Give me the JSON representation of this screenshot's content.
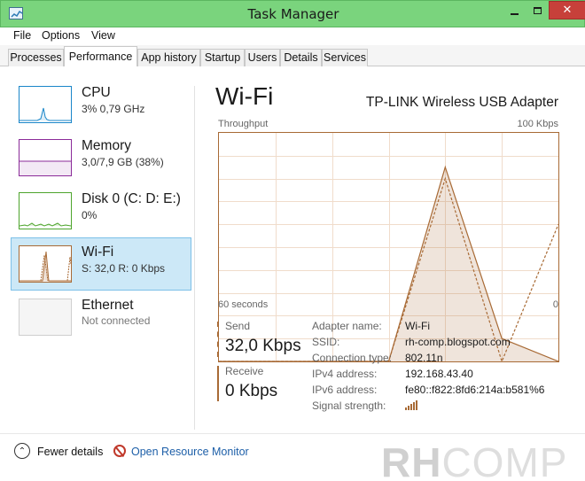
{
  "window": {
    "title": "Task Manager"
  },
  "menu": [
    "File",
    "Options",
    "View"
  ],
  "tabs": [
    {
      "label": "Processes",
      "active": false
    },
    {
      "label": "Performance",
      "active": true
    },
    {
      "label": "App history",
      "active": false
    },
    {
      "label": "Startup",
      "active": false
    },
    {
      "label": "Users",
      "active": false
    },
    {
      "label": "Details",
      "active": false
    },
    {
      "label": "Services",
      "active": false
    }
  ],
  "sidebar": [
    {
      "title": "CPU",
      "sub": "3% 0,79 GHz",
      "color": "#1a86c9",
      "selected": false
    },
    {
      "title": "Memory",
      "sub": "3,0/7,9 GB (38%)",
      "color": "#8b2b99",
      "selected": false
    },
    {
      "title": "Disk 0 (C: D: E:)",
      "sub": "0%",
      "color": "#4ea52d",
      "selected": false
    },
    {
      "title": "Wi-Fi",
      "sub": "S: 32,0  R: 0 Kbps",
      "color": "#a86a35",
      "selected": true
    },
    {
      "title": "Ethernet",
      "sub": "Not connected",
      "color": "#b5b5b5",
      "selected": false
    }
  ],
  "main": {
    "title": "Wi-Fi",
    "adapter": "TP-LINK Wireless USB Adapter",
    "graph_label_left": "Throughput",
    "graph_label_right": "100 Kbps",
    "graph_footer_left": "60 seconds",
    "graph_footer_right": "0",
    "accent": "#a86a35"
  },
  "stats": {
    "send_label": "Send",
    "send_value": "32,0 Kbps",
    "receive_label": "Receive",
    "receive_value": "0 Kbps"
  },
  "properties": [
    {
      "key": "Adapter name:",
      "value": "Wi-Fi"
    },
    {
      "key": "SSID:",
      "value": "rh-comp.blogspot.com"
    },
    {
      "key": "Connection type:",
      "value": "802.11n"
    },
    {
      "key": "IPv4 address:",
      "value": "192.168.43.40"
    },
    {
      "key": "IPv6 address:",
      "value": "fe80::f822:8fd6:214a:b581%6"
    },
    {
      "key": "Signal strength:",
      "value": ""
    }
  ],
  "footer": {
    "fewer_details": "Fewer details",
    "open_resource_monitor": "Open Resource Monitor"
  },
  "watermark": {
    "part1": "RH",
    "part2": "COMP"
  },
  "icons": {
    "app": "task-manager-icon",
    "signal": "signal-strength-icon",
    "fewer": "chevron-up-icon",
    "resource_monitor": "resource-monitor-icon"
  },
  "chart_data": {
    "type": "line",
    "ylim": [
      0,
      100
    ],
    "x": [
      60,
      50,
      40,
      30,
      20,
      10,
      0
    ],
    "xlabel": "",
    "ylabel": "",
    "series": [
      {
        "line_style": "solid",
        "values": [
          0,
          0,
          0,
          0,
          85,
          10,
          0
        ]
      },
      {
        "line_style": "dashed",
        "values": [
          0,
          0,
          0,
          0,
          80,
          0,
          60
        ]
      }
    ]
  }
}
